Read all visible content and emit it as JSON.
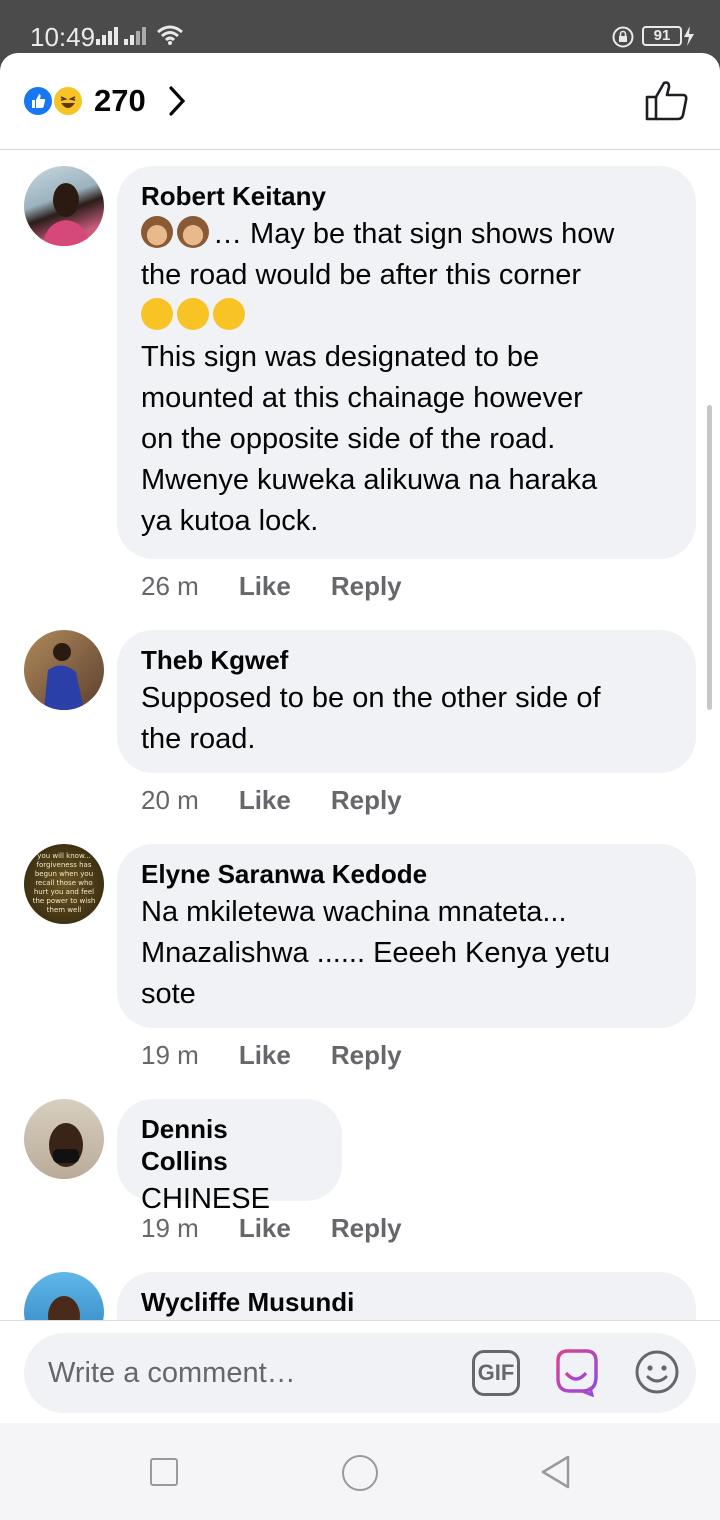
{
  "status_bar": {
    "time": "10:49",
    "battery": "91",
    "icons": [
      "signal-icon",
      "signal-icon",
      "wifi-icon",
      "lock-icon",
      "battery-icon",
      "charging-icon"
    ]
  },
  "reactions": {
    "count": "270",
    "types": [
      "like",
      "haha"
    ],
    "colors": {
      "like": "#1877f2",
      "haha": "#f7c325"
    }
  },
  "comments": [
    {
      "author": "Robert Keitany",
      "lines": [
        "… May be that sign shows how",
        "the road would be after this corner",
        "",
        "This sign was designated to be",
        "mounted at this chainage however",
        "on the opposite side of the road.",
        "Mwenye kuweka alikuwa na haraka",
        "ya kutoa lock."
      ],
      "time": "26 m",
      "like": "Like",
      "reply": "Reply"
    },
    {
      "author": "Theb Kgwef",
      "lines": [
        "Supposed to be on the other side of",
        "the road."
      ],
      "time": "20 m",
      "like": "Like",
      "reply": "Reply"
    },
    {
      "author": "Elyne Saranwa Kedode",
      "lines": [
        "Na mkiletewa wachina mnateta...",
        "Mnazalishwa ...... Eeeeh Kenya yetu",
        "sote"
      ],
      "avatar_text": "you will know... forgiveness has begun when you recall those who hurt you and feel the power to wish them well",
      "time": "19 m",
      "like": "Like",
      "reply": "Reply"
    },
    {
      "author": "Dennis Collins",
      "lines": [
        "CHINESE"
      ],
      "time": "19 m",
      "like": "Like",
      "reply": "Reply"
    },
    {
      "author": "Wycliffe Musundi"
    }
  ],
  "composer": {
    "placeholder": "Write a comment…",
    "gif_label": "GIF"
  },
  "colors": {
    "bubble": "#f0f2f5",
    "meta_text": "#65676b",
    "accent": "#1877f2"
  }
}
